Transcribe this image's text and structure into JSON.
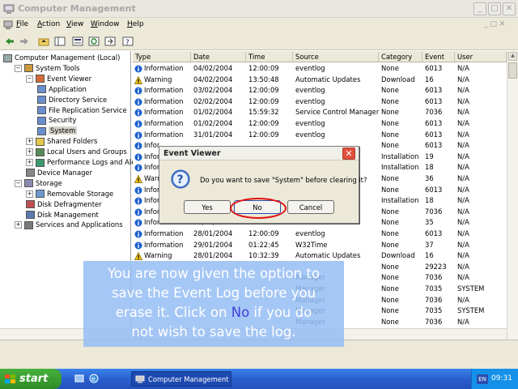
{
  "window": {
    "title": "Computer Management"
  },
  "menu": [
    {
      "label": "File"
    },
    {
      "label": "Action"
    },
    {
      "label": "View"
    },
    {
      "label": "Window"
    },
    {
      "label": "Help"
    }
  ],
  "tree": [
    {
      "label": "Computer Management (Local)",
      "level": 0,
      "expander": "",
      "icon": "computer-icon"
    },
    {
      "label": "System Tools",
      "level": 1,
      "expander": "−",
      "icon": "tools-icon"
    },
    {
      "label": "Event Viewer",
      "level": 2,
      "expander": "−",
      "icon": "event-viewer-icon"
    },
    {
      "label": "Application",
      "level": 3,
      "expander": "",
      "icon": "log-icon"
    },
    {
      "label": "Directory Service",
      "level": 3,
      "expander": "",
      "icon": "log-icon"
    },
    {
      "label": "File Replication Service",
      "level": 3,
      "expander": "",
      "icon": "log-icon"
    },
    {
      "label": "Security",
      "level": 3,
      "expander": "",
      "icon": "log-icon"
    },
    {
      "label": "System",
      "level": 3,
      "expander": "",
      "icon": "log-icon"
    },
    {
      "label": "Shared Folders",
      "level": 2,
      "expander": "+",
      "icon": "folder-icon"
    },
    {
      "label": "Local Users and Groups",
      "level": 2,
      "expander": "+",
      "icon": "users-icon"
    },
    {
      "label": "Performance Logs and Alerts",
      "level": 2,
      "expander": "+",
      "icon": "performance-icon"
    },
    {
      "label": "Device Manager",
      "level": 2,
      "expander": "",
      "icon": "device-manager-icon"
    },
    {
      "label": "Storage",
      "level": 1,
      "expander": "−",
      "icon": "storage-icon"
    },
    {
      "label": "Removable Storage",
      "level": 2,
      "expander": "+",
      "icon": "removable-storage-icon"
    },
    {
      "label": "Disk Defragmenter",
      "level": 2,
      "expander": "",
      "icon": "defrag-icon"
    },
    {
      "label": "Disk Management",
      "level": 2,
      "expander": "",
      "icon": "disk-management-icon"
    },
    {
      "label": "Services and Applications",
      "level": 1,
      "expander": "+",
      "icon": "services-icon"
    }
  ],
  "columns": [
    "Type",
    "Date",
    "Time",
    "Source",
    "Category",
    "Event",
    "User"
  ],
  "rows": [
    {
      "type": "Information",
      "date": "04/02/2004",
      "time": "12:00:09",
      "source": "eventlog",
      "category": "None",
      "event": "6013",
      "user": "N/A",
      "icon": "info"
    },
    {
      "type": "Warning",
      "date": "04/02/2004",
      "time": "13:50:48",
      "source": "Automatic Updates",
      "category": "Download",
      "event": "16",
      "user": "N/A",
      "icon": "warning"
    },
    {
      "type": "Information",
      "date": "03/02/2004",
      "time": "12:00:09",
      "source": "eventlog",
      "category": "None",
      "event": "6013",
      "user": "N/A",
      "icon": "info"
    },
    {
      "type": "Information",
      "date": "02/02/2004",
      "time": "12:00:09",
      "source": "eventlog",
      "category": "None",
      "event": "6013",
      "user": "N/A",
      "icon": "info"
    },
    {
      "type": "Information",
      "date": "01/02/2004",
      "time": "15:59:32",
      "source": "Service Control Manager",
      "category": "None",
      "event": "7036",
      "user": "N/A",
      "icon": "info"
    },
    {
      "type": "Information",
      "date": "01/02/2004",
      "time": "12:00:09",
      "source": "eventlog",
      "category": "None",
      "event": "6013",
      "user": "N/A",
      "icon": "info"
    },
    {
      "type": "Information",
      "date": "31/01/2004",
      "time": "12:00:09",
      "source": "eventlog",
      "category": "None",
      "event": "6013",
      "user": "N/A",
      "icon": "info"
    },
    {
      "type": "Infor",
      "date": "",
      "time": "",
      "source": "",
      "category": "None",
      "event": "6013",
      "user": "N/A",
      "icon": "info"
    },
    {
      "type": "Infor",
      "date": "",
      "time": "",
      "source": "",
      "category": "Installation",
      "event": "19",
      "user": "N/A",
      "icon": "info"
    },
    {
      "type": "Infor",
      "date": "",
      "time": "",
      "source": "",
      "category": "Installation",
      "event": "18",
      "user": "N/A",
      "icon": "info"
    },
    {
      "type": "Warn",
      "date": "",
      "time": "",
      "source": "",
      "category": "None",
      "event": "36",
      "user": "N/A",
      "icon": "warning"
    },
    {
      "type": "Infor",
      "date": "",
      "time": "",
      "source": "",
      "category": "None",
      "event": "6013",
      "user": "N/A",
      "icon": "info"
    },
    {
      "type": "Infor",
      "date": "",
      "time": "",
      "source": "",
      "category": "Installation",
      "event": "18",
      "user": "N/A",
      "icon": "info"
    },
    {
      "type": "Infor",
      "date": "",
      "time": "",
      "source": "ger",
      "category": "None",
      "event": "7036",
      "user": "N/A",
      "icon": "info"
    },
    {
      "type": "Information",
      "date": "28/01/2004",
      "time": "01:26:14",
      "source": "W32Time",
      "category": "None",
      "event": "35",
      "user": "N/A",
      "icon": "info"
    },
    {
      "type": "Information",
      "date": "28/01/2004",
      "time": "12:00:09",
      "source": "eventlog",
      "category": "None",
      "event": "6013",
      "user": "N/A",
      "icon": "info"
    },
    {
      "type": "Information",
      "date": "29/01/2004",
      "time": "01:22:45",
      "source": "W32Time",
      "category": "None",
      "event": "37",
      "user": "N/A",
      "icon": "info"
    },
    {
      "type": "Warning",
      "date": "28/01/2004",
      "time": "10:32:39",
      "source": "Automatic Updates",
      "category": "Download",
      "event": "16",
      "user": "N/A",
      "icon": "warning"
    },
    {
      "type": "",
      "date": "",
      "time": "",
      "source": "",
      "category": "None",
      "event": "29223",
      "user": "N/A",
      "icon": ""
    },
    {
      "type": "",
      "date": "",
      "time": "",
      "source": "Manager",
      "category": "None",
      "event": "7036",
      "user": "N/A",
      "icon": ""
    },
    {
      "type": "",
      "date": "",
      "time": "",
      "source": "Manager",
      "category": "None",
      "event": "7035",
      "user": "SYSTEM",
      "icon": ""
    },
    {
      "type": "",
      "date": "",
      "time": "",
      "source": "Manager",
      "category": "None",
      "event": "7036",
      "user": "N/A",
      "icon": ""
    },
    {
      "type": "",
      "date": "",
      "time": "",
      "source": "Manager",
      "category": "None",
      "event": "7035",
      "user": "SYSTEM",
      "icon": ""
    },
    {
      "type": "",
      "date": "",
      "time": "",
      "source": "Manager",
      "category": "None",
      "event": "7036",
      "user": "N/A",
      "icon": ""
    },
    {
      "type": "",
      "date": "",
      "time": "",
      "source": "Manager",
      "category": "None",
      "event": "7035",
      "user": "SYSTEM",
      "icon": ""
    }
  ],
  "dialog": {
    "title": "Event Viewer",
    "message": "Do you want to save \"System\" before clearing it?",
    "yes": "Yes",
    "no": "No",
    "cancel": "Cancel"
  },
  "tutorial": {
    "line1": "You are now given the option to",
    "line2": "save the Event Log before you",
    "line3a": "erase it. Click on ",
    "keyword": "No",
    "line3b": " if you do",
    "line4": "not wish to save the log."
  },
  "taskbar": {
    "start": "start",
    "task": "Computer Management",
    "lang": "EN",
    "clock": "09:31"
  },
  "colors": {
    "info": "#1a5fd0",
    "warning": "#f2c40c",
    "accent": "#2a5fcf"
  }
}
